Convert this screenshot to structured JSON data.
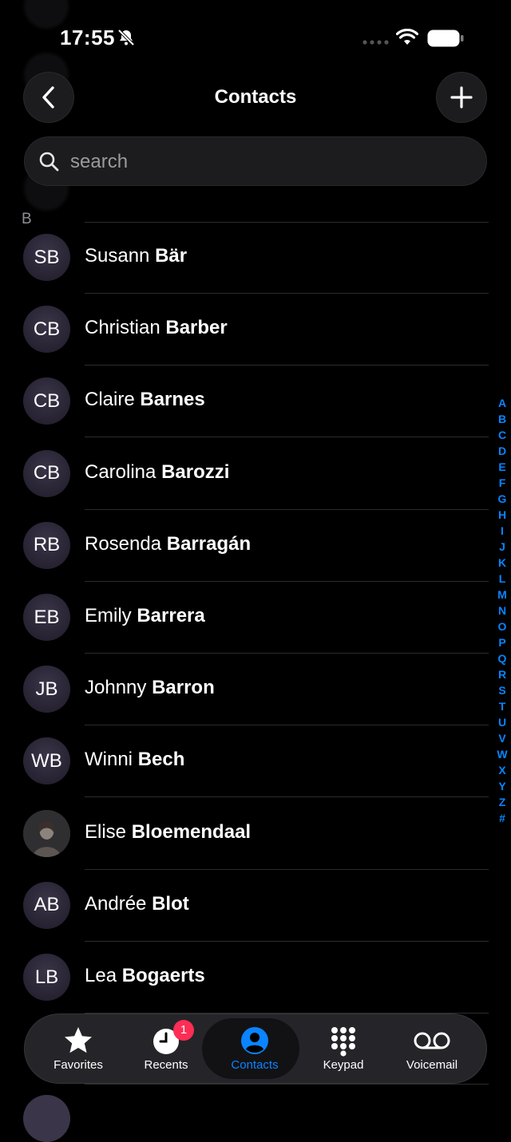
{
  "status_bar": {
    "time": "17:55"
  },
  "header": {
    "title": "Contacts"
  },
  "search": {
    "placeholder": "search"
  },
  "section": {
    "letter": "B"
  },
  "contacts": [
    {
      "initials": "SB",
      "first": "Susann",
      "last": "Bär",
      "photo": false
    },
    {
      "initials": "CB",
      "first": "Christian",
      "last": "Barber",
      "photo": false
    },
    {
      "initials": "CB",
      "first": "Claire",
      "last": "Barnes",
      "photo": false
    },
    {
      "initials": "CB",
      "first": "Carolina",
      "last": "Barozzi",
      "photo": false
    },
    {
      "initials": "RB",
      "first": "Rosenda",
      "last": "Barragán",
      "photo": false
    },
    {
      "initials": "EB",
      "first": "Emily",
      "last": "Barrera",
      "photo": false
    },
    {
      "initials": "JB",
      "first": "Johnny",
      "last": "Barron",
      "photo": false
    },
    {
      "initials": "WB",
      "first": "Winni",
      "last": "Bech",
      "photo": false
    },
    {
      "initials": "",
      "first": "Elise",
      "last": "Bloemendaal",
      "photo": true
    },
    {
      "initials": "AB",
      "first": "Andrée",
      "last": "Blot",
      "photo": false
    },
    {
      "initials": "LB",
      "first": "Lea",
      "last": "Bogaerts",
      "photo": false
    }
  ],
  "index_letters": [
    "A",
    "B",
    "C",
    "D",
    "E",
    "F",
    "G",
    "H",
    "I",
    "J",
    "K",
    "L",
    "M",
    "N",
    "O",
    "P",
    "Q",
    "R",
    "S",
    "T",
    "U",
    "V",
    "W",
    "X",
    "Y",
    "Z",
    "#"
  ],
  "tabs": [
    {
      "label": "Favorites",
      "icon": "star-icon",
      "active": false
    },
    {
      "label": "Recents",
      "icon": "clock-icon",
      "active": false,
      "badge": "1"
    },
    {
      "label": "Contacts",
      "icon": "person-circle-icon",
      "active": true
    },
    {
      "label": "Keypad",
      "icon": "keypad-icon",
      "active": false
    },
    {
      "label": "Voicemail",
      "icon": "voicemail-icon",
      "active": false
    }
  ],
  "colors": {
    "accent": "#0a84ff",
    "badge": "#ff2d55",
    "background": "#000000"
  }
}
